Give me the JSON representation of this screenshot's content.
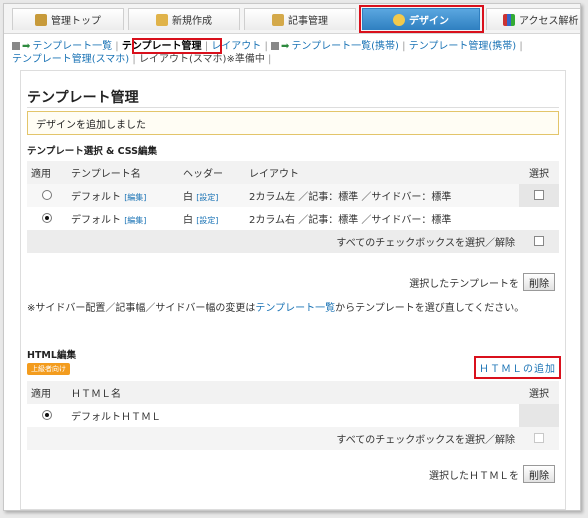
{
  "nav": {
    "tabs": [
      {
        "label": "管理トップ",
        "icon": "home-icon"
      },
      {
        "label": "新規作成",
        "icon": "pencil-icon"
      },
      {
        "label": "記事管理",
        "icon": "document-icon"
      },
      {
        "label": "デザイン",
        "icon": "palette-icon"
      },
      {
        "label": "アクセス解析",
        "icon": "bar-chart-icon"
      }
    ]
  },
  "subnav": {
    "template_list": "テンプレート一覧",
    "template_manage": "テンプレート管理",
    "layout": "レイアウト",
    "template_list_mobile": "テンプレート一覧(携帯)",
    "template_manage_mobile": "テンプレート管理(携帯)",
    "template_manage_smartphone": "テンプレート管理(スマホ)",
    "layout_smartphone": "レイアウト(スマホ)※準備中"
  },
  "page": {
    "title": "テンプレート管理",
    "notice": "デザインを追加しました"
  },
  "template_section": {
    "title": "テンプレート選択 & CSS編集",
    "headers": {
      "apply": "適用",
      "name": "テンプレート名",
      "header": "ヘッダー",
      "layout": "レイアウト",
      "select": "選択"
    },
    "rows": [
      {
        "name": "デフォルト",
        "edit": "[編集]",
        "header": "白",
        "setting": "[設定]",
        "layout": "2カラム左 ／記事：標準 ／サイドバー：標準",
        "selected": false
      },
      {
        "name": "デフォルト",
        "edit": "[編集]",
        "header": "白",
        "setting": "[設定]",
        "layout": "2カラム右 ／記事：標準 ／サイドバー：標準",
        "selected": true
      }
    ],
    "select_all": "すべてのチェックボックスを選択／解除",
    "selected_label": "選択したテンプレートを",
    "delete_button": "削除"
  },
  "note": {
    "before": "※サイドバー配置／記事幅／サイドバー幅の変更は",
    "link": "テンプレート一覧",
    "after": "からテンプレートを選び直してください。"
  },
  "html_section": {
    "title": "HTML編集",
    "badge": "上級者向け",
    "add_link": "ＨＴＭＬの追加",
    "headers": {
      "apply": "適用",
      "name": "ＨＴＭＬ名",
      "select": "選択"
    },
    "rows": [
      {
        "name": "デフォルトＨＴＭＬ",
        "selected": true
      }
    ],
    "select_all": "すべてのチェックボックスを選択／解除",
    "selected_label": "選択したＨＴＭＬを",
    "delete_button": "削除"
  },
  "colors": {
    "accent": "#2f7fc0",
    "highlight": "#d9101c",
    "link": "#1a73b5",
    "badge": "#f39c1e"
  }
}
